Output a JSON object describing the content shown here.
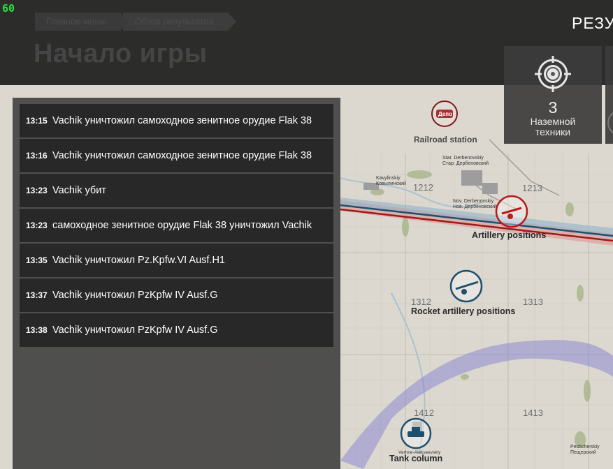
{
  "hud": {
    "fps": "60"
  },
  "header": {
    "breadcrumb": [
      "Главное меню",
      "Обзор результатов"
    ],
    "title": "Начало игры",
    "result_label": "РЕЗУ"
  },
  "stats": [
    {
      "icon": "ground-vehicle-target-icon",
      "count": "3",
      "label_line1": "Наземной",
      "label_line2": "техники"
    }
  ],
  "log": [
    {
      "time": "13:15",
      "text": "Vachik уничтожил самоходное зенитное орудие Flak 38"
    },
    {
      "time": "13:16",
      "text": "Vachik уничтожил самоходное зенитное орудие Flak 38"
    },
    {
      "time": "13:23",
      "text": "Vachik убит"
    },
    {
      "time": "13:23",
      "text": "самоходное зенитное орудие Flak 38 уничтожил Vachik"
    },
    {
      "time": "13:35",
      "text": "Vachik уничтожил Pz.Kpfw.VI Ausf.H1"
    },
    {
      "time": "13:37",
      "text": "Vachik уничтожил PzKpfw IV Ausf.G"
    },
    {
      "time": "13:38",
      "text": "Vachik уничтожил PzKpfw IV Ausf.G"
    }
  ],
  "map": {
    "grid_labels": [
      "1212",
      "1213",
      "1312",
      "1313",
      "1412",
      "1413"
    ],
    "objectives": [
      {
        "label": "Railroad station",
        "team": "enemy"
      },
      {
        "label": "Artillery positions",
        "team": "enemy"
      },
      {
        "label": "Rocket artillery positions",
        "team": "ally"
      },
      {
        "label": "Tank column",
        "team": "ally"
      }
    ],
    "places": [
      {
        "name": "Kavylinskiy",
        "name_ru": "Ковылинский"
      },
      {
        "name": "Star. Derbenovskiy",
        "name_ru": "Стар. Дербеновский"
      },
      {
        "name": "Nov. Derbenovskiy",
        "name_ru": "Нов. Дербеновский"
      },
      {
        "name": "Peshcherskiy",
        "name_ru": "Пещерский"
      },
      {
        "name": "Verhne-Alekseevskiy",
        "name_ru": ""
      }
    ],
    "railroad_label": "Депо",
    "colors": {
      "enemy": "#b81c1c",
      "ally": "#1f4f6e",
      "path": "#5a5aa8"
    }
  }
}
